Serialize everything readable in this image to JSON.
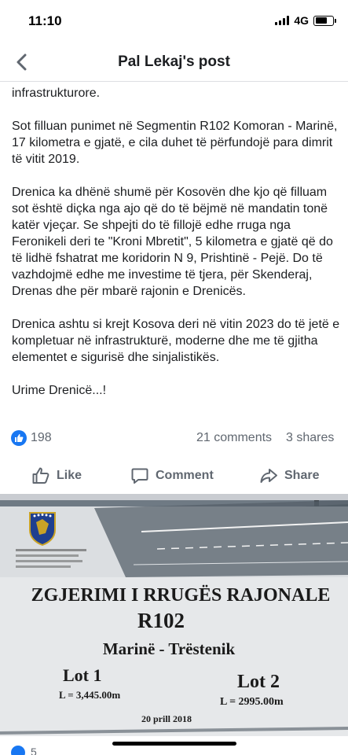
{
  "status_bar": {
    "time": "11:10",
    "network": "4G"
  },
  "nav": {
    "title": "Pal Lekaj's post",
    "back_icon": "chevron-left-icon"
  },
  "post": {
    "paragraphs": [
      "infrastrukturore.",
      "Sot filluan punimet në Segmentin R102 Komoran - Marinë, 17 kilometra e gjatë, e cila duhet të përfundojë para dimrit të vitit 2019.",
      "Drenica ka dhënë shumë për Kosovën dhe kjo që filluam sot është diçka nga ajo që do të bëjmë në mandatin tonë katër vjeçar. Se shpejti do të fillojë edhe rruga nga Feronikeli  deri te \"Kroni Mbretit\", 5 kilometra e gjatë që do të lidhë fshatrat me koridorin N 9, Prishtinë - Pejë. Do të vazhdojmë edhe me investime të tjera, për Skenderaj, Drenas dhe për mbarë rajonin e Drenicës.",
      "Drenica ashtu si krejt Kosova deri në vitin 2023 do të jetë e kompletuar në infrastrukturë, moderne dhe me të gjitha elementet e sigurisë dhe sinjalistikës.",
      "Urime Drenicë...!"
    ]
  },
  "reactions": {
    "count": "198",
    "comments": "21 comments",
    "shares": "3 shares"
  },
  "actions": {
    "like": "Like",
    "comment": "Comment",
    "share": "Share"
  },
  "photo": {
    "sign_title": "ZGJERIMI I RRUGËS RAJONALE",
    "sign_road": "R102",
    "sign_route": "Marinë - Trëstenik",
    "lot1_label": "Lot 1",
    "lot1_length": "L = 3,445.00m",
    "lot2_label": "Lot 2",
    "lot2_length": "L = 2995.00m",
    "date": "20 prill 2018"
  },
  "photo_footer": {
    "like_count": "5"
  },
  "colors": {
    "facebook_blue": "#1877f2",
    "secondary_text": "#606770"
  }
}
